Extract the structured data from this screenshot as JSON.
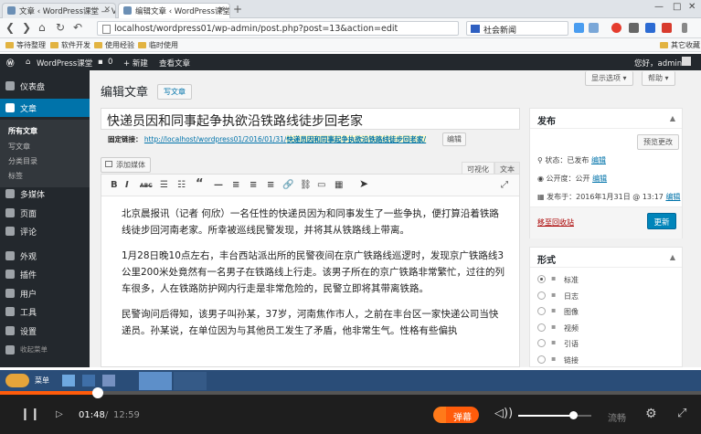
{
  "browser": {
    "tabs": [
      "文章 ‹ WordPress课堂 — V",
      "编辑文章 ‹ WordPress课堂"
    ],
    "new_tab": "+",
    "window_controls": [
      "—",
      "□",
      "✕"
    ],
    "url": "localhost/wordpress01/wp-admin/post.php?post=13&action=edit",
    "search_value": "社会新闻",
    "bookmarks": [
      "等待整理",
      "软件开发",
      "使用经验",
      "临时使用"
    ],
    "bookmarks_right": "其它收藏"
  },
  "adminbar": {
    "site": "WordPress课堂",
    "comments": "0",
    "new": "+ 新建",
    "view_post": "查看文章",
    "greeting": "您好，admin"
  },
  "sidebar": {
    "items": [
      {
        "label": "仪表盘",
        "icon": "dashboard-icon"
      },
      {
        "label": "文章",
        "icon": "pin-icon",
        "current": true
      },
      {
        "label": "多媒体",
        "icon": "media-icon"
      },
      {
        "label": "页面",
        "icon": "page-icon"
      },
      {
        "label": "评论",
        "icon": "comment-icon"
      },
      {
        "label": "外观",
        "icon": "brush-icon"
      },
      {
        "label": "插件",
        "icon": "plugin-icon"
      },
      {
        "label": "用户",
        "icon": "user-icon"
      },
      {
        "label": "工具",
        "icon": "wrench-icon"
      },
      {
        "label": "设置",
        "icon": "settings-icon"
      },
      {
        "label": "收起菜单",
        "icon": "collapse-icon"
      }
    ],
    "submenu": [
      "所有文章",
      "写文章",
      "分类目录",
      "标签"
    ]
  },
  "page": {
    "heading": "编辑文章",
    "add_new": "写文章",
    "screen_options": "显示选项 ▾",
    "help": "帮助 ▾",
    "post_title": "快递员因和同事起争执欲沿铁路线徒步回老家",
    "permalink_label": "固定链接：",
    "permalink_base": "http://localhost/wordpress01/2016/01/31/",
    "permalink_slug": "快递员因和同事起争执欲沿铁路线徒步回老家/",
    "permalink_edit": "编辑",
    "add_media": "添加媒体",
    "tab_visual": "可视化",
    "tab_text": "文本"
  },
  "editor": {
    "toolbar": [
      "B",
      "I",
      "ABC",
      "☰",
      "☷",
      "“",
      "—",
      "≡",
      "≡",
      "≡",
      "🔗",
      "⛓",
      "▭",
      "▦"
    ],
    "fullscreen": "⤢",
    "paragraphs": [
      "北京晨报讯（记者 何欣）一名任性的快递员因为和同事发生了一些争执，便打算沿着铁路线徒步回河南老家。所幸被巡线民警发现，并将其从铁路线上带离。",
      "1月28日晚10点左右，丰台西站派出所的民警夜间在京广铁路线巡逻时，发现京广铁路线3公里200米处竟然有一名男子在铁路线上行走。该男子所在的京广铁路非常繁忙，过往的列车很多，人在铁路防护网内行走是非常危险的，民警立即将其带离铁路。",
      "民警询问后得知，该男子叫孙某，37岁，河南焦作市人，之前在丰台区一家快递公司当快递员。孙某说，在单位因为与其他员工发生了矛盾，他非常生气。性格有些偏执"
    ]
  },
  "publish": {
    "title": "发布",
    "preview": "预览更改",
    "status_label": "状态：已发布",
    "status_edit": "编辑",
    "visibility_label": "公开度：公开",
    "visibility_edit": "编辑",
    "date_label": "发布于：2016年1月31日 @ 13:17",
    "date_edit": "编辑",
    "trash": "移至回收站",
    "update": "更新"
  },
  "format": {
    "title": "形式",
    "options": [
      "标准",
      "日志",
      "图像",
      "视频",
      "引语",
      "链接"
    ],
    "selected": 0
  },
  "player": {
    "current": "01:48",
    "total": "12:59",
    "progress": 0.139,
    "danmaku": "弹幕",
    "quality": "流畅",
    "volume": 0.75
  },
  "taskbar": {
    "start_label": "菜单"
  },
  "colors": {
    "wp_dark": "#23282d",
    "wp_blue": "#0073aa",
    "player_accent": "#ff5c0b"
  }
}
